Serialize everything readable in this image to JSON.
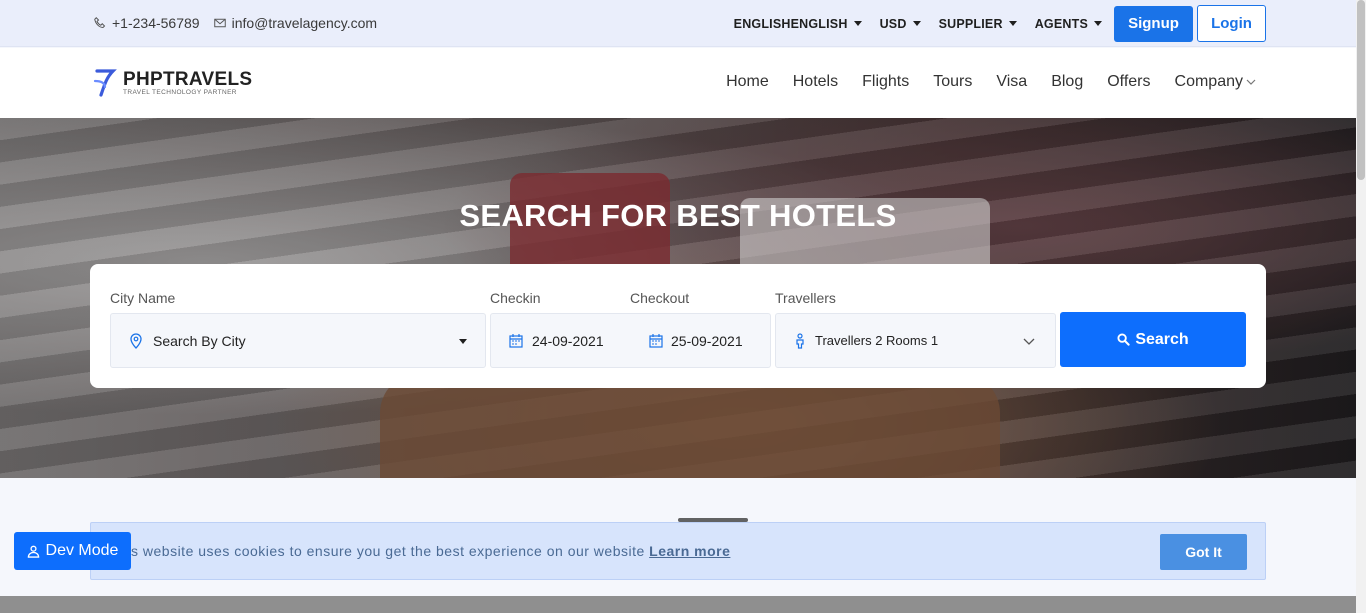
{
  "topbar": {
    "phone": "+1-234-56789",
    "email": "info@travelagency.com",
    "language": "ENGLISHENGLISH",
    "currency": "USD",
    "supplier": "SUPPLIER",
    "agents": "AGENTS",
    "signup": "Signup",
    "login": "Login"
  },
  "nav": {
    "brand": "PHPTRAVELS",
    "tagline": "TRAVEL TECHNOLOGY PARTNER",
    "items": [
      "Home",
      "Hotels",
      "Flights",
      "Tours",
      "Visa",
      "Blog",
      "Offers",
      "Company"
    ]
  },
  "hero": {
    "title": "SEARCH FOR BEST HOTELS"
  },
  "search": {
    "city_label": "City Name",
    "city_placeholder": "Search By City",
    "checkin_label": "Checkin",
    "checkin_value": "24-09-2021",
    "checkout_label": "Checkout",
    "checkout_value": "25-09-2021",
    "travellers_label": "Travellers",
    "travellers_value": "Travellers 2 Rooms 1",
    "button": "Search"
  },
  "cookie": {
    "message": "s website uses cookies to ensure you get the best experience on our website",
    "learn_more": "Learn more",
    "button": "Got It"
  },
  "devmode": {
    "label": "Dev Mode"
  },
  "colors": {
    "primary": "#0d6efd",
    "topbar_bg": "#eaeefb",
    "cookie_bg": "#d7e4fc"
  }
}
